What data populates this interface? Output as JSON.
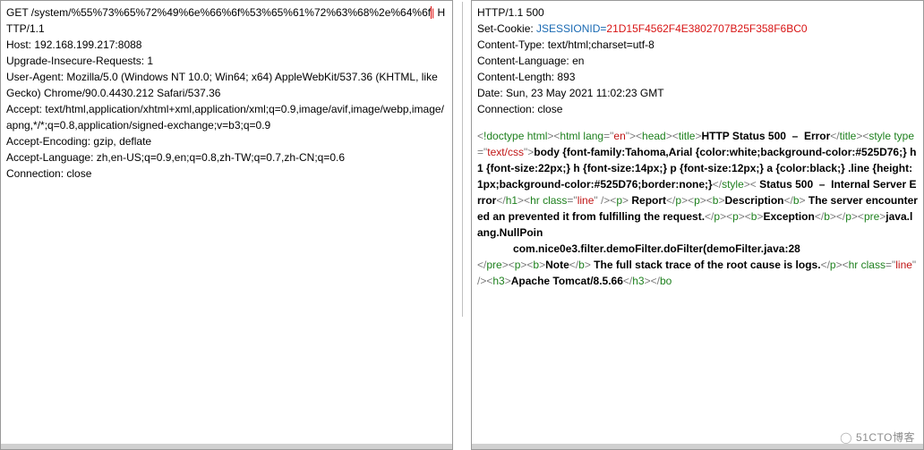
{
  "request": {
    "lines": [
      {
        "segs": [
          {
            "t": "GET /system/%55%73%65%72%49%6e%66%6f%53%65%61%72%63%68%2e%64%6f"
          },
          {
            "t": "|",
            "cls": "cursor-mark"
          },
          {
            "t": " HTTP/1.1"
          }
        ]
      },
      {
        "segs": [
          {
            "t": "Host: 192.168.199.217:8088"
          }
        ]
      },
      {
        "segs": [
          {
            "t": "Upgrade-Insecure-Requests: 1"
          }
        ]
      },
      {
        "segs": [
          {
            "t": "User-Agent: Mozilla/5.0 (Windows NT 10.0; Win64; x64) AppleWebKit/537.36 (KHTML, like Gecko) Chrome/90.0.4430.212 Safari/537.36"
          }
        ]
      },
      {
        "segs": [
          {
            "t": "Accept: text/html,application/xhtml+xml,application/xml;q=0.9,image/avif,image/webp,image/apng,*/*;q=0.8,application/signed-exchange;v=b3;q=0.9"
          }
        ]
      },
      {
        "segs": [
          {
            "t": "Accept-Encoding: gzip, deflate"
          }
        ]
      },
      {
        "segs": [
          {
            "t": "Accept-Language: zh,en-US;q=0.9,en;q=0.8,zh-TW;q=0.7,zh-CN;q=0.6"
          }
        ]
      },
      {
        "segs": [
          {
            "t": "Connection: close"
          }
        ]
      }
    ]
  },
  "response": {
    "headers": [
      {
        "segs": [
          {
            "t": "HTTP/1.1 500"
          }
        ]
      },
      {
        "segs": [
          {
            "t": "Set-Cookie: "
          },
          {
            "t": "JSESSIONID",
            "cls": "cookie-name"
          },
          {
            "t": "=",
            "cls": "cookie-sep"
          },
          {
            "t": "21D15F4562F4E3802707B25F358F6BC0",
            "cls": "cookie-val"
          }
        ]
      },
      {
        "segs": [
          {
            "t": "Content-Type: text/html;charset=utf-8"
          }
        ]
      },
      {
        "segs": [
          {
            "t": "Content-Language: en"
          }
        ]
      },
      {
        "segs": [
          {
            "t": "Content-Length: 893"
          }
        ]
      },
      {
        "segs": [
          {
            "t": "Date: Sun, 23 May 2021 11:02:23 GMT"
          }
        ]
      },
      {
        "segs": [
          {
            "t": "Connection: close"
          }
        ]
      }
    ],
    "body": [
      {
        "t": "<",
        "cls": "punct"
      },
      {
        "t": "!doctype html",
        "cls": "tag"
      },
      {
        "t": "><",
        "cls": "punct"
      },
      {
        "t": "html lang",
        "cls": "tag"
      },
      {
        "t": "=\"",
        "cls": "punct"
      },
      {
        "t": "en",
        "cls": "str"
      },
      {
        "t": "\"><",
        "cls": "punct"
      },
      {
        "t": "head",
        "cls": "tag"
      },
      {
        "t": "><",
        "cls": "punct"
      },
      {
        "t": "title",
        "cls": "tag"
      },
      {
        "t": ">",
        "cls": "punct"
      },
      {
        "t": "HTTP Status 500  –  Error",
        "cls": "bold"
      },
      {
        "t": "</",
        "cls": "punct"
      },
      {
        "t": "title",
        "cls": "tag"
      },
      {
        "t": "><",
        "cls": "punct"
      },
      {
        "t": "style type",
        "cls": "tag"
      },
      {
        "t": "=\"",
        "cls": "punct"
      },
      {
        "t": "text/css",
        "cls": "str"
      },
      {
        "t": "\">",
        "cls": "punct"
      },
      {
        "t": "body {font-family:Tahoma,Arial {color:white;background-color:#525D76;} h1 {font-size:22px;} h {font-size:14px;} p {font-size:12px;} a {color:black;} .line {height:1px;background-color:#525D76;border:none;}",
        "cls": "bold"
      },
      {
        "t": "</",
        "cls": "punct"
      },
      {
        "t": "style",
        "cls": "tag"
      },
      {
        "t": "><",
        "cls": "punct"
      },
      {
        "t": " Status 500  –  Internal Server Error",
        "cls": "bold"
      },
      {
        "t": "</",
        "cls": "punct"
      },
      {
        "t": "h1",
        "cls": "tag"
      },
      {
        "t": "><",
        "cls": "punct"
      },
      {
        "t": "hr class",
        "cls": "tag"
      },
      {
        "t": "=\"",
        "cls": "punct"
      },
      {
        "t": "line",
        "cls": "str"
      },
      {
        "t": "\" /><",
        "cls": "punct"
      },
      {
        "t": "p",
        "cls": "tag"
      },
      {
        "t": ">",
        "cls": "punct"
      },
      {
        "t": " Report",
        "cls": "bold"
      },
      {
        "t": "</",
        "cls": "punct"
      },
      {
        "t": "p",
        "cls": "tag"
      },
      {
        "t": "><",
        "cls": "punct"
      },
      {
        "t": "p",
        "cls": "tag"
      },
      {
        "t": "><",
        "cls": "punct"
      },
      {
        "t": "b",
        "cls": "tag"
      },
      {
        "t": ">",
        "cls": "punct"
      },
      {
        "t": "Description",
        "cls": "bold"
      },
      {
        "t": "</",
        "cls": "punct"
      },
      {
        "t": "b",
        "cls": "tag"
      },
      {
        "t": ">",
        "cls": "punct"
      },
      {
        "t": " The server encountered an prevented it from fulfilling the request.",
        "cls": "bold"
      },
      {
        "t": "</",
        "cls": "punct"
      },
      {
        "t": "p",
        "cls": "tag"
      },
      {
        "t": "><",
        "cls": "punct"
      },
      {
        "t": "p",
        "cls": "tag"
      },
      {
        "t": "><",
        "cls": "punct"
      },
      {
        "t": "b",
        "cls": "tag"
      },
      {
        "t": ">",
        "cls": "punct"
      },
      {
        "t": "Exception",
        "cls": "bold"
      },
      {
        "t": "</",
        "cls": "punct"
      },
      {
        "t": "b",
        "cls": "tag"
      },
      {
        "t": "></",
        "cls": "punct"
      },
      {
        "t": "p",
        "cls": "tag"
      },
      {
        "t": "><",
        "cls": "punct"
      },
      {
        "t": "pre",
        "cls": "tag"
      },
      {
        "t": ">",
        "cls": "punct"
      },
      {
        "t": "java.lang.NullPoin\n            com.nice0e3.filter.demoFilter.doFilter(demoFilter.java:28",
        "cls": "bold"
      },
      {
        "t": "\n</",
        "cls": "punct"
      },
      {
        "t": "pre",
        "cls": "tag"
      },
      {
        "t": "><",
        "cls": "punct"
      },
      {
        "t": "p",
        "cls": "tag"
      },
      {
        "t": "><",
        "cls": "punct"
      },
      {
        "t": "b",
        "cls": "tag"
      },
      {
        "t": ">",
        "cls": "punct"
      },
      {
        "t": "Note",
        "cls": "bold"
      },
      {
        "t": "</",
        "cls": "punct"
      },
      {
        "t": "b",
        "cls": "tag"
      },
      {
        "t": ">",
        "cls": "punct"
      },
      {
        "t": " The full stack trace of the root cause is logs.",
        "cls": "bold"
      },
      {
        "t": "</",
        "cls": "punct"
      },
      {
        "t": "p",
        "cls": "tag"
      },
      {
        "t": "><",
        "cls": "punct"
      },
      {
        "t": "hr class",
        "cls": "tag"
      },
      {
        "t": "=\"",
        "cls": "punct"
      },
      {
        "t": "line",
        "cls": "str"
      },
      {
        "t": "\" /><",
        "cls": "punct"
      },
      {
        "t": "h3",
        "cls": "tag"
      },
      {
        "t": ">",
        "cls": "punct"
      },
      {
        "t": "Apache Tomcat/8.5.66",
        "cls": "bold"
      },
      {
        "t": "</",
        "cls": "punct"
      },
      {
        "t": "h3",
        "cls": "tag"
      },
      {
        "t": "></",
        "cls": "punct"
      },
      {
        "t": "bo",
        "cls": "tag"
      }
    ]
  },
  "watermark": "51CTO博客"
}
